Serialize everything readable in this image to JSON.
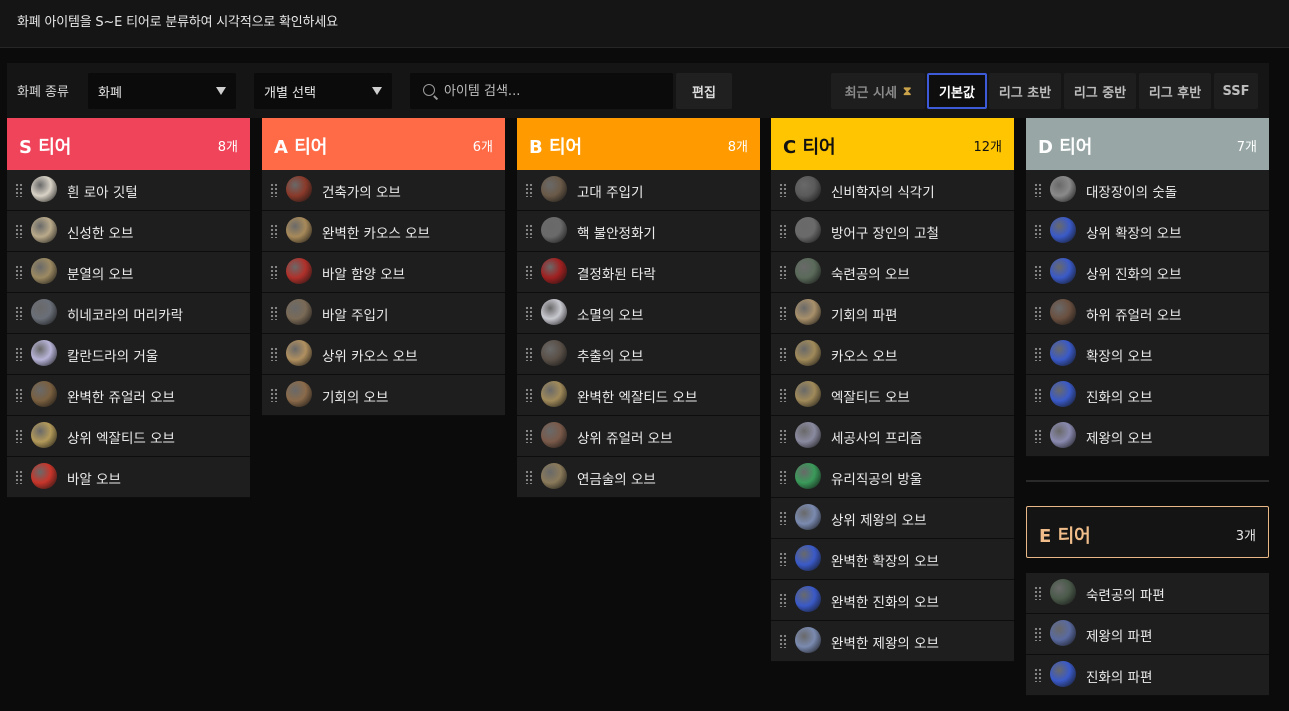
{
  "header": {
    "description": "화폐 아이템을 S~E 티어로 분류하여 시각적으로 확인하세요"
  },
  "controls": {
    "category_label": "화폐 종류",
    "category_value": "화폐",
    "individual_value": "개별 선택",
    "search_placeholder": "아이템 검색...",
    "edit_label": "편집",
    "presets": [
      "최근 시세",
      "기본값",
      "리그 초반",
      "리그 중반",
      "리그 후반",
      "SSF"
    ],
    "active_preset": "기본값"
  },
  "tiers": [
    {
      "name": "S 티어",
      "count": "8개",
      "color": "#f0445a",
      "items": [
        "흰 로아 깃털",
        "신성한 오브",
        "분열의 오브",
        "히네코라의 머리카락",
        "칼란드라의 거울",
        "완벽한 쥬얼러 오브",
        "상위 엑잘티드 오브",
        "바알 오브"
      ],
      "icons": [
        "#d8d2c6",
        "#b9aa8a",
        "#9c8a62",
        "#6a6f78",
        "#b7b4d8",
        "#7a6040",
        "#b39a5a",
        "#c8352a"
      ]
    },
    {
      "name": "A 티어",
      "count": "6개",
      "color": "#ff6a47",
      "items": [
        "건축가의 오브",
        "완벽한 카오스 오브",
        "바알 함양 오브",
        "바알 주입기",
        "상위 카오스 오브",
        "기회의 오브"
      ],
      "icons": [
        "#8a3a2a",
        "#a88a5a",
        "#b0302a",
        "#7a6a56",
        "#b09060",
        "#8a6a4a"
      ]
    },
    {
      "name": "B 티어",
      "count": "8개",
      "color": "#ff9a00",
      "items": [
        "고대 주입기",
        "핵 불안정화기",
        "결정화된 타락",
        "소멸의 오브",
        "추출의 오브",
        "완벽한 엑잘티드 오브",
        "상위 쥬얼러 오브",
        "연금술의 오브"
      ],
      "icons": [
        "#6a5a48",
        "#6a6a6a",
        "#a02020",
        "#c8c8d0",
        "#5a5048",
        "#a08a5a",
        "#7a5a4a",
        "#8a7a5a"
      ]
    },
    {
      "name": "C 티어",
      "count": "12개",
      "color": "#ffc500",
      "items": [
        "신비학자의 식각기",
        "방어구 장인의 고철",
        "숙련공의 오브",
        "기회의 파편",
        "카오스 오브",
        "엑잘티드 오브",
        "세공사의 프리즘",
        "유리직공의 방울",
        "상위 제왕의 오브",
        "완벽한 확장의 오브",
        "완벽한 진화의 오브",
        "완벽한 제왕의 오브"
      ],
      "icons": [
        "#5a5a5a",
        "#6a6a6a",
        "#5a6a5a",
        "#a8906a",
        "#a08a5a",
        "#a08a5a",
        "#8a8aa0",
        "#3a9a5a",
        "#7a8ab0",
        "#3a5ac8",
        "#3a5ac8",
        "#7a8ab0"
      ]
    },
    {
      "name": "D 티어",
      "count": "7개",
      "color": "#98a6a6",
      "items": [
        "대장장이의 숫돌",
        "상위 확장의 오브",
        "상위 진화의 오브",
        "하위 쥬얼러 오브",
        "확장의 오브",
        "진화의 오브",
        "제왕의 오브"
      ],
      "icons": [
        "#8a8a8a",
        "#3a5ac8",
        "#3a5ac8",
        "#6a5040",
        "#3a5ac8",
        "#3a5ac8",
        "#8a8ab0"
      ]
    },
    {
      "name": "E 티어",
      "count": "3개",
      "color": "#f0bd8a",
      "items": [
        "숙련공의 파편",
        "제왕의 파편",
        "진화의 파편"
      ],
      "icons": [
        "#4a5a4a",
        "#5a6aa0",
        "#3a5ac8"
      ]
    }
  ]
}
